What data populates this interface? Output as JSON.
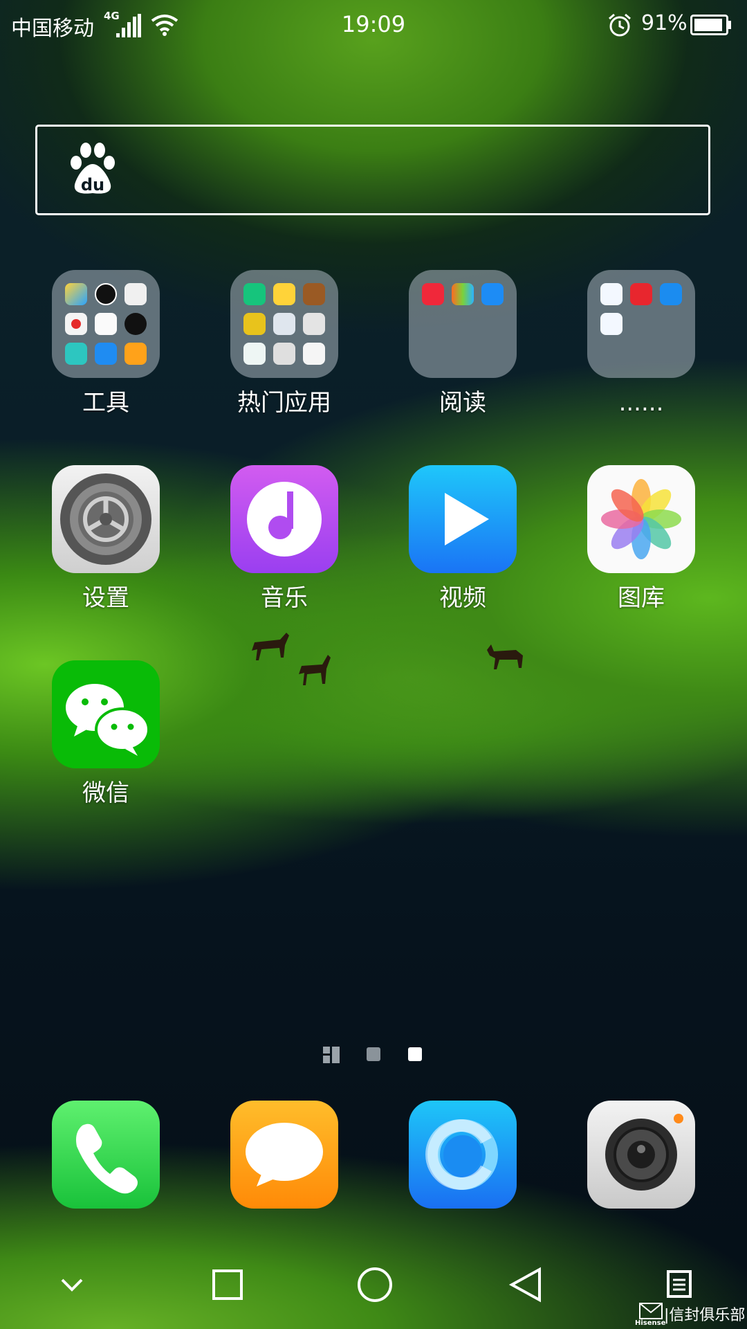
{
  "status_bar": {
    "carrier": "中国移动",
    "network": "4G",
    "time": "19:09",
    "battery_percent": "91%",
    "battery_level": 0.91,
    "icons": [
      "signal-icon",
      "wifi-icon",
      "alarm-icon",
      "battery-icon"
    ]
  },
  "search": {
    "icon": "baidu-paw-icon",
    "logo_text": "du"
  },
  "apps": {
    "folder_tools": "工具",
    "folder_popular": "热门应用",
    "folder_reading": "阅读",
    "folder_misc": "......",
    "settings": "设置",
    "music": "音乐",
    "video": "视频",
    "gallery": "图库",
    "wechat": "微信"
  },
  "page_indicator": {
    "pages": 3,
    "current": 3
  },
  "dock": {
    "items": [
      "phone-icon",
      "messages-icon",
      "browser-icon",
      "camera-icon"
    ]
  },
  "nav_bar": {
    "items": [
      "chevron-down-icon",
      "recents-square-icon",
      "home-circle-icon",
      "back-triangle-icon",
      "menu-icon"
    ]
  },
  "watermark": {
    "brand": "Hisense",
    "text": "|信封俱乐部"
  },
  "colors": {
    "wechat": "#09bb07",
    "music": "#b04cf0",
    "video": "#1a8cff",
    "phone": "#2fd04a",
    "messages": "#ff9d0a"
  }
}
